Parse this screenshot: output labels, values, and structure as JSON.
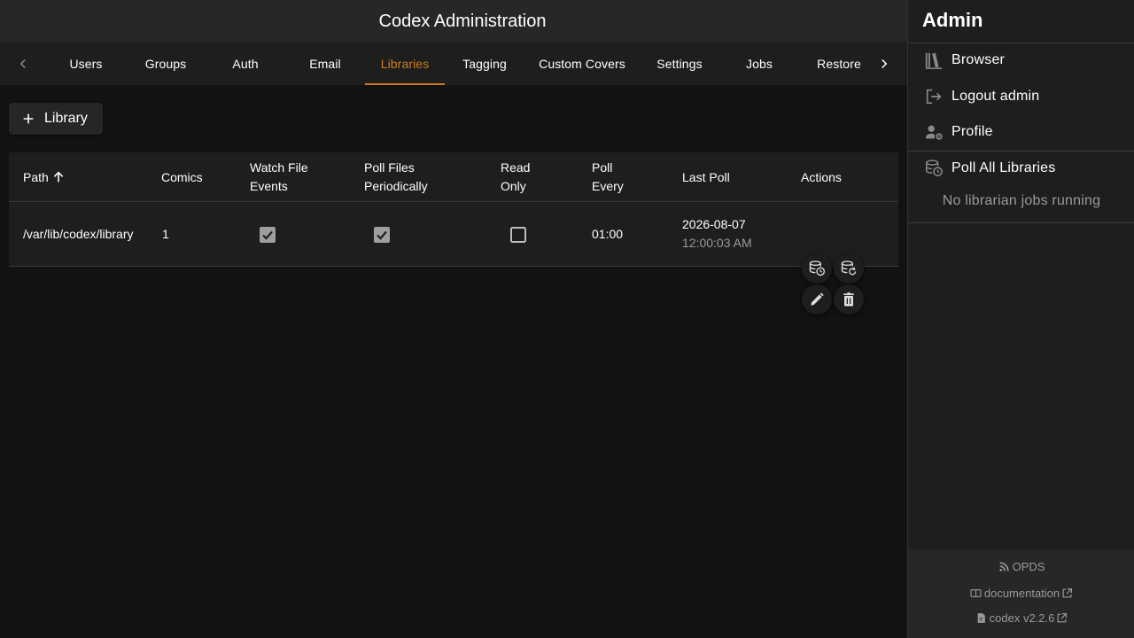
{
  "header": {
    "title": "Codex Administration"
  },
  "tabs": [
    {
      "label": "Users"
    },
    {
      "label": "Groups"
    },
    {
      "label": "Auth"
    },
    {
      "label": "Email"
    },
    {
      "label": "Libraries"
    },
    {
      "label": "Tagging"
    },
    {
      "label": "Custom Covers"
    },
    {
      "label": "Settings"
    },
    {
      "label": "Jobs"
    },
    {
      "label": "Restore"
    }
  ],
  "active_tab": "Libraries",
  "toolbar": {
    "add_label": "Library"
  },
  "table": {
    "columns": {
      "path": "Path",
      "comics": "Comics",
      "watch_1": "Watch File",
      "watch_2": "Events",
      "poll_1": "Poll Files",
      "poll_2": "Periodically",
      "read_1": "Read",
      "read_2": "Only",
      "every_1": "Poll",
      "every_2": "Every",
      "last_poll": "Last Poll",
      "actions": "Actions"
    },
    "sort": {
      "column": "Path",
      "direction": "ascending"
    },
    "rows": [
      {
        "path": "/var/lib/codex/library",
        "comics": "1",
        "watch_file_events": true,
        "poll_files_periodically": true,
        "read_only": false,
        "poll_every": "01:00",
        "last_poll_date": "2026-08-07",
        "last_poll_time": "12:00:03 AM"
      }
    ]
  },
  "sidebar": {
    "title": "Admin",
    "items": [
      {
        "label": "Browser",
        "icon": "library-shelves-icon"
      },
      {
        "label": "Logout admin",
        "icon": "logout-icon"
      },
      {
        "label": "Profile",
        "icon": "account-cog-icon"
      },
      {
        "label": "Poll All Libraries",
        "icon": "database-clock-icon"
      }
    ],
    "status": "No librarian jobs running",
    "footer": {
      "opds": "OPDS",
      "documentation": "documentation",
      "version": "codex v2.2.6"
    }
  },
  "colors": {
    "accent": "#cc7b19",
    "background": "#121212",
    "surface": "#1e1e1e",
    "bar": "#272727",
    "muted_text": "#9a9a9a"
  }
}
